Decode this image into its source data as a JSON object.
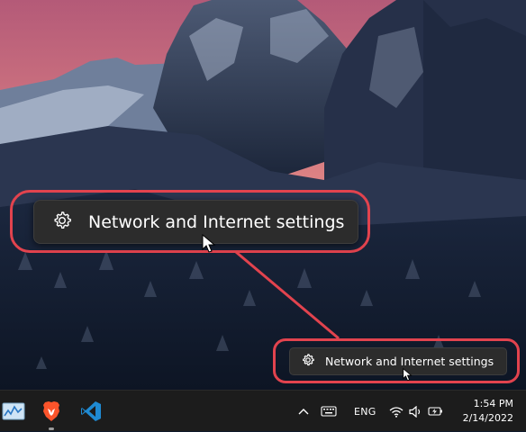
{
  "context_menu": {
    "item_label": "Network and Internet settings",
    "icon": "gear-icon"
  },
  "zoom_callout": {
    "item_label": "Network and Internet settings",
    "icon": "gear-icon",
    "highlight_color": "#e2434e"
  },
  "taskbar": {
    "apps": [
      {
        "name": "resource-monitor-app",
        "icon": "chart-window-icon"
      },
      {
        "name": "brave-browser",
        "icon": "brave-lion-icon"
      },
      {
        "name": "visual-studio-code",
        "icon": "vscode-icon"
      }
    ],
    "tray": {
      "chevron_icon": "chevron-up-icon",
      "keyboard_icon": "keyboard-icon",
      "language": "ENG",
      "wifi_icon": "wifi-icon",
      "volume_icon": "speaker-icon",
      "battery_icon": "battery-charging-icon"
    },
    "clock": {
      "time": "1:54 PM",
      "date": "2/14/2022"
    }
  }
}
